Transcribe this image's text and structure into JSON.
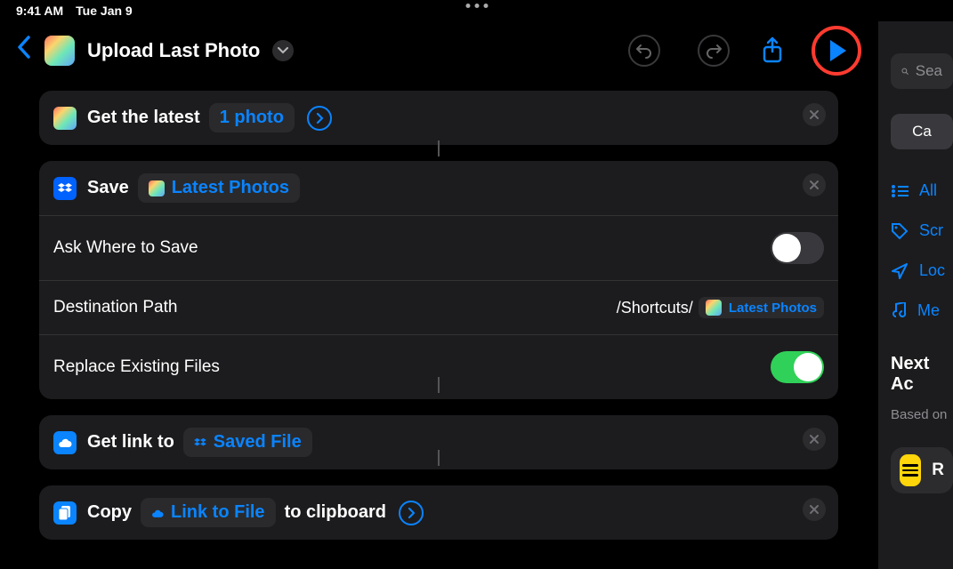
{
  "statusbar": {
    "time": "9:41 AM",
    "date": "Tue Jan 9"
  },
  "header": {
    "title": "Upload Last Photo"
  },
  "actions": [
    {
      "id": "get-latest",
      "prefix": "Get the latest",
      "param": "1 photo"
    },
    {
      "id": "save",
      "prefix": "Save",
      "param": "Latest Photos",
      "settings": {
        "ask_label": "Ask Where to Save",
        "ask_on": false,
        "dest_label": "Destination Path",
        "dest_prefix": "/Shortcuts/",
        "dest_var": "Latest Photos",
        "replace_label": "Replace Existing Files",
        "replace_on": true
      }
    },
    {
      "id": "get-link",
      "prefix": "Get link to",
      "param": "Saved File"
    },
    {
      "id": "copy",
      "prefix": "Copy",
      "param": "Link to File",
      "suffix": "to clipboard"
    }
  ],
  "sidebar": {
    "search_placeholder": "Sea",
    "category_btn": "Ca",
    "items": [
      {
        "label": "All"
      },
      {
        "label": "Scr"
      },
      {
        "label": "Loc"
      },
      {
        "label": "Me"
      }
    ],
    "next_heading": "Next Ac",
    "next_sub": "Based on",
    "suggestion_label": "R"
  }
}
